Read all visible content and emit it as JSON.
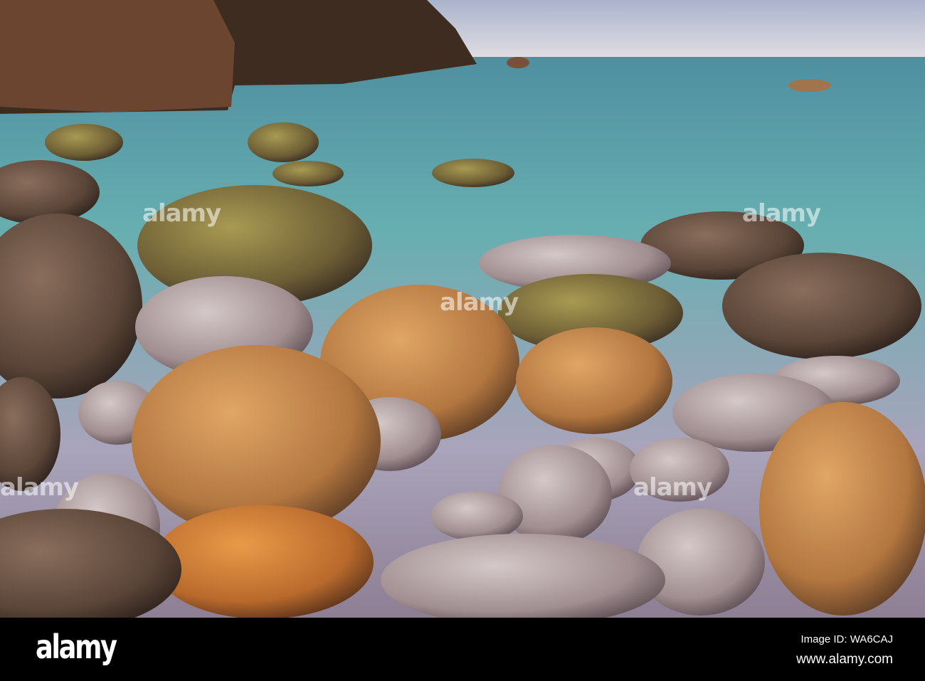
{
  "photo": {
    "subject": "Granite boulders on a misty shoreline",
    "colors": {
      "sky": "#c9ccd8",
      "sea": "#5fa5ab",
      "mist": "#b9a9bd",
      "cliff": "#4a3424",
      "boulder_warm": "#c5874a",
      "boulder_grey": "#a8968f"
    }
  },
  "watermark": {
    "text": "alamy"
  },
  "footer": {
    "logo": "alamy",
    "image_id": "Image ID: WA6CAJ",
    "website": "www.alamy.com"
  }
}
